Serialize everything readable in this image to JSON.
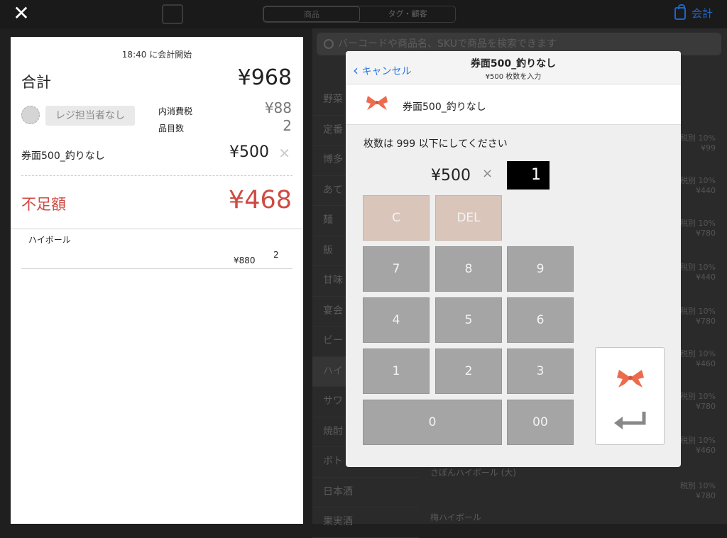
{
  "topbar": {
    "close": "✕",
    "tab_products": "商品",
    "tab_tags": "タグ・顧客",
    "checkout": "会計"
  },
  "catalog": {
    "search_placeholder": "バーコードや商品名、SKUで商品を検索できます",
    "categories": [
      "野菜",
      "定番",
      "博多",
      "あて",
      "麺",
      "飯",
      "甘味",
      "宴会",
      "ビー",
      "ハイ",
      "サワ",
      "焼酎",
      "ボト",
      "日本酒",
      "果実酒"
    ],
    "rows": [
      {
        "tax": "税別 10%",
        "price": "¥99"
      },
      {
        "tax": "税別 10%",
        "price": "¥440"
      },
      {
        "tax": "税別 10%",
        "price": "¥780"
      },
      {
        "tax": "税別 10%",
        "price": "¥440"
      },
      {
        "tax": "税別 10%",
        "price": "¥780"
      },
      {
        "tax": "税別 10%",
        "price": "¥460"
      },
      {
        "tax": "税別 10%",
        "price": "¥780"
      },
      {
        "tax": "税別 10%",
        "price": "¥460"
      },
      {
        "tax": "税別 10%",
        "price": "¥780"
      }
    ],
    "product_name_1": "さぼんハイボール (大)",
    "product_name_2": "梅ハイボール"
  },
  "cart": {
    "start": "18:40 に会計開始",
    "total_label": "合計",
    "total_value": "¥968",
    "staff": "レジ担当者なし",
    "tax_label": "内消費税",
    "tax_value": "¥88",
    "items_label": "品目数",
    "items_value": "2",
    "voucher_name": "券面500_釣りなし",
    "voucher_value": "¥500",
    "voucher_remove": "✕",
    "shortage_label": "不足額",
    "shortage_value": "¥468",
    "line_name": "ハイボール",
    "line_price": "¥880",
    "line_qty": "2"
  },
  "modal": {
    "cancel": "キャンセル",
    "title": "券面500_釣りなし",
    "subtitle": "¥500 枚数を入力",
    "item_name": "券面500_釣りなし",
    "warning": "枚数は 999 以下にしてください",
    "price": "¥500",
    "times": "×",
    "qty": "1",
    "keys": {
      "c": "C",
      "del": "DEL",
      "k7": "7",
      "k8": "8",
      "k9": "9",
      "k4": "4",
      "k5": "5",
      "k6": "6",
      "k1": "1",
      "k2": "2",
      "k3": "3",
      "k0": "0",
      "k00": "00"
    }
  },
  "colors": {
    "accent_blue": "#2d7ae0",
    "shortage_red": "#cf4a42",
    "ribbon": "#ee6a4d"
  }
}
